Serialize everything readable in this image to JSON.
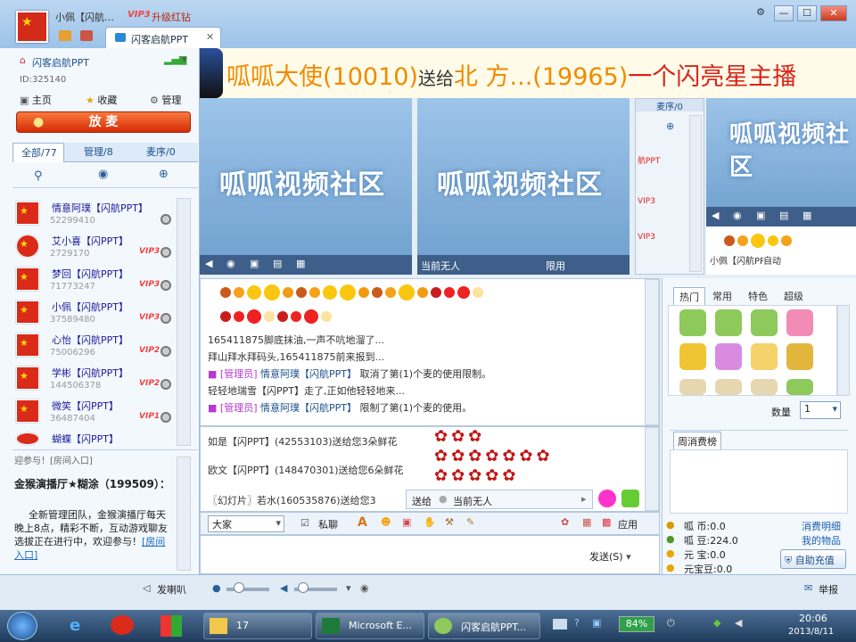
{
  "window": {
    "user_name": "小佩【闪航…",
    "vip_badge": "VIP3",
    "upgrade_text": "升级红钻",
    "tab_title": "闪客启航PPT",
    "controls": [
      "⚙",
      "—",
      "☐",
      "✕"
    ]
  },
  "room": {
    "name": "闪客启航PPT",
    "room_id": "ID:325140",
    "nav": [
      {
        "label": "主页",
        "icon": "home-icon"
      },
      {
        "label": "收藏",
        "icon": "star-icon"
      },
      {
        "label": "管理",
        "icon": "gear-icon"
      }
    ],
    "mic_button": "放 麦"
  },
  "user_tabs": [
    {
      "label": "全部/77",
      "active": true
    },
    {
      "label": "管理/8",
      "active": false
    },
    {
      "label": "麦序/0",
      "active": false
    }
  ],
  "users": [
    {
      "name": "情意阿璞【闪航PPT】",
      "id": "52299410",
      "vip": ""
    },
    {
      "name": "艾小喜【闪PPT】",
      "id": "2729170",
      "vip": "VIP3"
    },
    {
      "name": "梦回【闪航PPT】",
      "id": "71773247",
      "vip": "VIP3"
    },
    {
      "name": "小佩【闪航PPT】",
      "id": "37589480",
      "vip": "VIP3"
    },
    {
      "name": "心怡【闪航PPT】",
      "id": "75006296",
      "vip": "VIP2"
    },
    {
      "name": "学彬【闪航PPT】",
      "id": "144506378",
      "vip": "VIP2"
    },
    {
      "name": "微笑【闪PPT】",
      "id": "36487404",
      "vip": "VIP1"
    },
    {
      "name": "蝴蝶【闪PPT】",
      "id": "",
      "vip": ""
    }
  ],
  "announcement": {
    "partial_top": "迎参与！[房间入口]",
    "title": "金猴演播厅★糊涂（199509）：",
    "body": "全新管理团队，金猴演播厅每天晚上8点，精彩不断，互动游戏聊友选拔正在进行中，欢迎参与！",
    "link": "[房间入口]"
  },
  "banner": {
    "sender": "呱呱大使(10010)",
    "action": "送给",
    "receiver": "北 方...(19965)",
    "gift": "一个闪亮星主播"
  },
  "video": {
    "watermark": "呱呱视频社区",
    "slot2_status": "当前无人",
    "slot2_limit": "限用",
    "queue_label": "麦序/0",
    "slot4_user": "小佩【闪航PPT】",
    "slot4_mode": "自动"
  },
  "chat": [
    {
      "text": "165411875脚底抹油,一声不吭地溜了...",
      "tag": "",
      "name": ""
    },
    {
      "text": "拜山拜水拜码头,165411875前来报到...",
      "tag": "",
      "name": ""
    },
    {
      "tag": "[管理员]",
      "name": "情意阿璞【闪航PPT】",
      "text": "取消了第(1)个麦的使用限制。"
    },
    {
      "text": "轻轻地瑞雪【闪PPT】走了,正如他轻轻地来...",
      "tag": "",
      "name": ""
    },
    {
      "tag": "[管理员]",
      "name": "情意阿璞【闪航PPT】",
      "text": "限制了第(1)个麦的使用。"
    }
  ],
  "gifts_log": [
    {
      "text": "如是【闪PPT】(42553103)送给您3朵鲜花"
    },
    {
      "text": "欧文【闪PPT】(148470301)送给您6朵鲜花"
    },
    {
      "text": "〖幻灯片〗若水(160535876)送给您3"
    }
  ],
  "send_to": {
    "label": "送给",
    "value": "当前无人"
  },
  "toolbar": {
    "target": "大家",
    "private": "私聊",
    "apply": "应用"
  },
  "send_button": "发送(S)",
  "gift_panel": {
    "tabs": [
      "热门",
      "常用",
      "特色",
      "超级"
    ],
    "quantity_label": "数量",
    "quantity": "1",
    "weekly": "周消费榜"
  },
  "wallet": {
    "guagua_coin": "呱 币:0.0",
    "guagua_bean": "呱 豆:224.0",
    "yuanbao": "元 宝:0.0",
    "yuanbao_bean": "元宝豆:0.0",
    "detail": "消费明细",
    "items": "我的物品",
    "self_charge": "自助充值"
  },
  "bottom": {
    "speaker": "发喇叭",
    "report": "举报"
  },
  "taskbar": {
    "apps": [
      {
        "label": "17"
      },
      {
        "label": "Microsoft E..."
      },
      {
        "label": "闪客启航PPT..."
      }
    ],
    "battery": "84%",
    "time": "20:06",
    "date": "2013/8/11"
  },
  "colors": {
    "accent": "#e02c1c",
    "blue": "#1b4f8a",
    "banner_orange": "#f08a00"
  }
}
